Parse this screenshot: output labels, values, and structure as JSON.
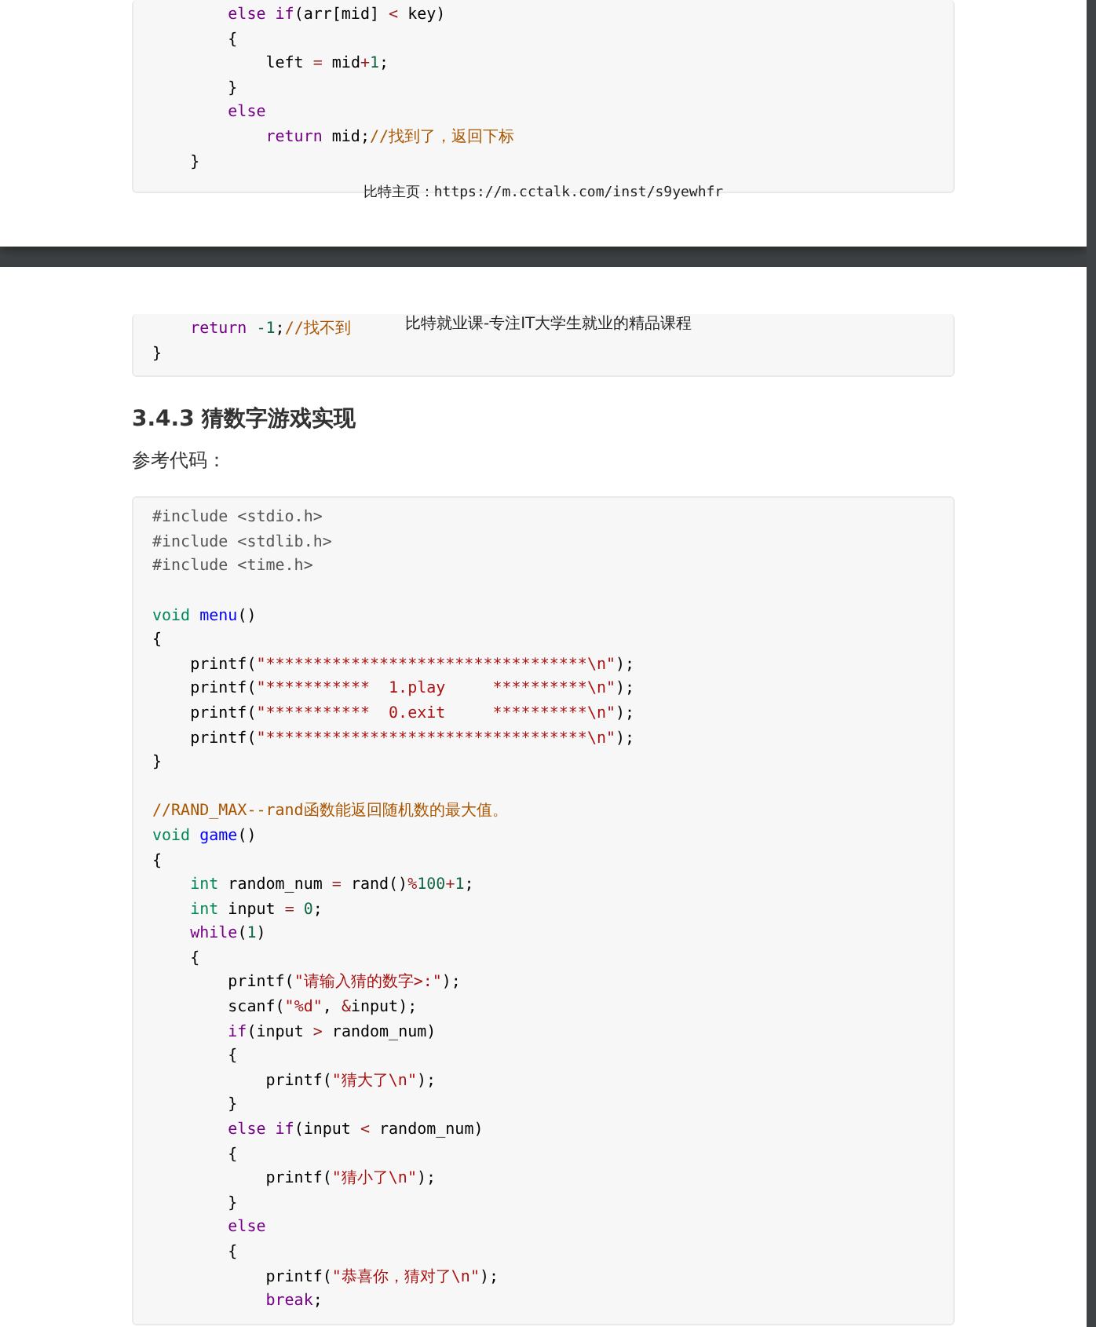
{
  "page_1": {
    "code_block": {
      "lines": [
        {
          "kind": "code",
          "tokens": [
            {
              "t": "        else",
              "color": "#770088"
            },
            {
              "t": " if",
              "color": "#770088"
            },
            {
              "t": "(arr[mid] ",
              "color": "#000000"
            },
            {
              "t": "<",
              "color": "#981a1a"
            },
            {
              "t": " key)",
              "color": "#000000"
            }
          ]
        },
        {
          "kind": "code",
          "tokens": [
            {
              "t": "        {",
              "color": "#000000"
            }
          ]
        },
        {
          "kind": "code",
          "tokens": [
            {
              "t": "            left ",
              "color": "#000000"
            },
            {
              "t": "=",
              "color": "#981a1a"
            },
            {
              "t": " mid",
              "color": "#000000"
            },
            {
              "t": "+",
              "color": "#981a1a"
            },
            {
              "t": "1",
              "color": "#116644"
            },
            {
              "t": ";",
              "color": "#000000"
            }
          ]
        },
        {
          "kind": "code",
          "tokens": [
            {
              "t": "        }",
              "color": "#000000"
            }
          ]
        },
        {
          "kind": "code",
          "tokens": [
            {
              "t": "        else",
              "color": "#770088"
            }
          ]
        },
        {
          "kind": "code",
          "tokens": [
            {
              "t": "            return",
              "color": "#770088"
            },
            {
              "t": " mid;",
              "color": "#000000"
            },
            {
              "t": "//找到了，返回下标",
              "color": "#aa5500"
            }
          ]
        },
        {
          "kind": "code",
          "tokens": [
            {
              "t": "    }",
              "color": "#000000"
            }
          ]
        }
      ]
    },
    "footer": "比特主页：https://m.cctalk.com/inst/s9yewhfr"
  },
  "page_2": {
    "header": "比特就业课-专注IT大学生就业的精品课程",
    "code_block_1": {
      "lines": [
        {
          "kind": "code",
          "tokens": [
            {
              "t": "    return",
              "color": "#770088"
            },
            {
              "t": " -1",
              "color": "#116644"
            },
            {
              "t": ";",
              "color": "#000000"
            },
            {
              "t": "//找不到",
              "color": "#aa5500"
            }
          ]
        },
        {
          "kind": "code",
          "tokens": [
            {
              "t": "}",
              "color": "#000000"
            }
          ]
        }
      ]
    },
    "heading": "3.4.3 猜数字游戏实现",
    "paragraph": "参考代码：",
    "code_block_2": {
      "lines": [
        {
          "kind": "code",
          "tokens": [
            {
              "t": "#include <stdio.h>",
              "color": "#555555"
            }
          ]
        },
        {
          "kind": "code",
          "tokens": [
            {
              "t": "#include <stdlib.h>",
              "color": "#555555"
            }
          ]
        },
        {
          "kind": "code",
          "tokens": [
            {
              "t": "#include <time.h>",
              "color": "#555555"
            }
          ]
        },
        {
          "kind": "blank"
        },
        {
          "kind": "code",
          "tokens": [
            {
              "t": "void",
              "color": "#008855"
            },
            {
              "t": " menu",
              "color": "#0000ff"
            },
            {
              "t": "()",
              "color": "#000000"
            }
          ]
        },
        {
          "kind": "code",
          "tokens": [
            {
              "t": "{",
              "color": "#000000"
            }
          ]
        },
        {
          "kind": "code",
          "tokens": [
            {
              "t": "    printf(",
              "color": "#000000"
            },
            {
              "t": "\"**********************************\\n\"",
              "color": "#aa1111"
            },
            {
              "t": ");",
              "color": "#000000"
            }
          ]
        },
        {
          "kind": "code",
          "tokens": [
            {
              "t": "    printf(",
              "color": "#000000"
            },
            {
              "t": "\"***********  1.play     **********\\n\"",
              "color": "#aa1111"
            },
            {
              "t": ");",
              "color": "#000000"
            }
          ]
        },
        {
          "kind": "code",
          "tokens": [
            {
              "t": "    printf(",
              "color": "#000000"
            },
            {
              "t": "\"***********  0.exit     **********\\n\"",
              "color": "#aa1111"
            },
            {
              "t": ");",
              "color": "#000000"
            }
          ]
        },
        {
          "kind": "code",
          "tokens": [
            {
              "t": "    printf(",
              "color": "#000000"
            },
            {
              "t": "\"**********************************\\n\"",
              "color": "#aa1111"
            },
            {
              "t": ");",
              "color": "#000000"
            }
          ]
        },
        {
          "kind": "code",
          "tokens": [
            {
              "t": "}",
              "color": "#000000"
            }
          ]
        },
        {
          "kind": "blank"
        },
        {
          "kind": "code",
          "tokens": [
            {
              "t": "//RAND_MAX--rand函数能返回随机数的最大值。",
              "color": "#aa5500"
            }
          ]
        },
        {
          "kind": "code",
          "tokens": [
            {
              "t": "void",
              "color": "#008855"
            },
            {
              "t": " game",
              "color": "#0000ff"
            },
            {
              "t": "()",
              "color": "#000000"
            }
          ]
        },
        {
          "kind": "code",
          "tokens": [
            {
              "t": "{",
              "color": "#000000"
            }
          ]
        },
        {
          "kind": "code",
          "tokens": [
            {
              "t": "    int",
              "color": "#008855"
            },
            {
              "t": " random_num ",
              "color": "#000000"
            },
            {
              "t": "=",
              "color": "#981a1a"
            },
            {
              "t": " rand()",
              "color": "#000000"
            },
            {
              "t": "%",
              "color": "#981a1a"
            },
            {
              "t": "100",
              "color": "#116644"
            },
            {
              "t": "+",
              "color": "#981a1a"
            },
            {
              "t": "1",
              "color": "#116644"
            },
            {
              "t": ";",
              "color": "#000000"
            }
          ]
        },
        {
          "kind": "code",
          "tokens": [
            {
              "t": "    int",
              "color": "#008855"
            },
            {
              "t": " input ",
              "color": "#000000"
            },
            {
              "t": "=",
              "color": "#981a1a"
            },
            {
              "t": " 0",
              "color": "#116644"
            },
            {
              "t": ";",
              "color": "#000000"
            }
          ]
        },
        {
          "kind": "code",
          "tokens": [
            {
              "t": "    while",
              "color": "#770088"
            },
            {
              "t": "(",
              "color": "#000000"
            },
            {
              "t": "1",
              "color": "#116644"
            },
            {
              "t": ")",
              "color": "#000000"
            }
          ]
        },
        {
          "kind": "code",
          "tokens": [
            {
              "t": "    {",
              "color": "#000000"
            }
          ]
        },
        {
          "kind": "code",
          "tokens": [
            {
              "t": "        printf(",
              "color": "#000000"
            },
            {
              "t": "\"请输入猜的数字>:\"",
              "color": "#aa1111"
            },
            {
              "t": ");",
              "color": "#000000"
            }
          ]
        },
        {
          "kind": "code",
          "tokens": [
            {
              "t": "        scanf(",
              "color": "#000000"
            },
            {
              "t": "\"%d\"",
              "color": "#aa1111"
            },
            {
              "t": ", ",
              "color": "#000000"
            },
            {
              "t": "&",
              "color": "#981a1a"
            },
            {
              "t": "input);",
              "color": "#000000"
            }
          ]
        },
        {
          "kind": "code",
          "tokens": [
            {
              "t": "        if",
              "color": "#770088"
            },
            {
              "t": "(input ",
              "color": "#000000"
            },
            {
              "t": ">",
              "color": "#981a1a"
            },
            {
              "t": " random_num)",
              "color": "#000000"
            }
          ]
        },
        {
          "kind": "code",
          "tokens": [
            {
              "t": "        {",
              "color": "#000000"
            }
          ]
        },
        {
          "kind": "code",
          "tokens": [
            {
              "t": "            printf(",
              "color": "#000000"
            },
            {
              "t": "\"猜大了\\n\"",
              "color": "#aa1111"
            },
            {
              "t": ");",
              "color": "#000000"
            }
          ]
        },
        {
          "kind": "code",
          "tokens": [
            {
              "t": "        }",
              "color": "#000000"
            }
          ]
        },
        {
          "kind": "code",
          "tokens": [
            {
              "t": "        else",
              "color": "#770088"
            },
            {
              "t": " if",
              "color": "#770088"
            },
            {
              "t": "(input ",
              "color": "#000000"
            },
            {
              "t": "<",
              "color": "#981a1a"
            },
            {
              "t": " random_num)",
              "color": "#000000"
            }
          ]
        },
        {
          "kind": "code",
          "tokens": [
            {
              "t": "        {",
              "color": "#000000"
            }
          ]
        },
        {
          "kind": "code",
          "tokens": [
            {
              "t": "            printf(",
              "color": "#000000"
            },
            {
              "t": "\"猜小了\\n\"",
              "color": "#aa1111"
            },
            {
              "t": ");",
              "color": "#000000"
            }
          ]
        },
        {
          "kind": "code",
          "tokens": [
            {
              "t": "        }",
              "color": "#000000"
            }
          ]
        },
        {
          "kind": "code",
          "tokens": [
            {
              "t": "        else",
              "color": "#770088"
            }
          ]
        },
        {
          "kind": "code",
          "tokens": [
            {
              "t": "        {",
              "color": "#000000"
            }
          ]
        },
        {
          "kind": "code",
          "tokens": [
            {
              "t": "            printf(",
              "color": "#000000"
            },
            {
              "t": "\"恭喜你，猜对了\\n\"",
              "color": "#aa1111"
            },
            {
              "t": ");",
              "color": "#000000"
            }
          ]
        },
        {
          "kind": "code",
          "tokens": [
            {
              "t": "            break",
              "color": "#770088"
            },
            {
              "t": ";",
              "color": "#000000"
            }
          ]
        }
      ]
    }
  }
}
